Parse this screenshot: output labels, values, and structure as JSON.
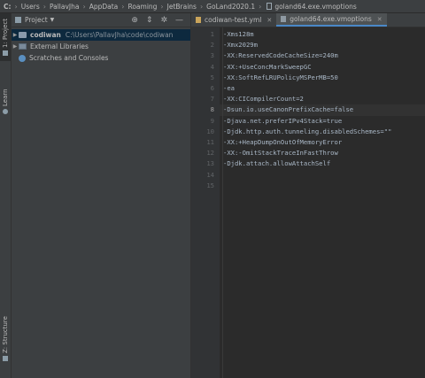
{
  "breadcrumb": {
    "items": [
      "C:",
      "Users",
      "PallavJha",
      "AppData",
      "Roaming",
      "JetBrains",
      "GoLand2020.1",
      "goland64.exe.vmoptions"
    ]
  },
  "sidebar": {
    "project_label": "1: Project",
    "learn_label": "Learn",
    "structure_label": "Z: Structure"
  },
  "project_panel": {
    "title": "Project",
    "tree": [
      {
        "name": "codiwan",
        "path": "C:\\Users\\PallavJha\\code\\codiwan"
      },
      {
        "name": "External Libraries"
      },
      {
        "name": "Scratches and Consoles"
      }
    ]
  },
  "tabs": [
    {
      "label": "codiwan-test.yml"
    },
    {
      "label": "goland64.exe.vmoptions"
    }
  ],
  "editor": {
    "current_line": 8,
    "lines": [
      "-Xms128m",
      "-Xmx2029m",
      "-XX:ReservedCodeCacheSize=240m",
      "-XX:+UseConcMarkSweepGC",
      "-XX:SoftRefLRUPolicyMSPerMB=50",
      "-ea",
      "-XX:CICompilerCount=2",
      "-Dsun.io.useCanonPrefixCache=false",
      "-Djava.net.preferIPv4Stack=true",
      "-Djdk.http.auth.tunneling.disabledSchemes=\"\"",
      "-XX:+HeapDumpOnOutOfMemoryError",
      "-XX:-OmitStackTraceInFastThrow",
      "-Djdk.attach.allowAttachSelf",
      "",
      ""
    ],
    "line_numbers": [
      "1",
      "2",
      "3",
      "4",
      "5",
      "6",
      "7",
      "8",
      "9",
      "10",
      "11",
      "12",
      "13",
      "14",
      "15"
    ]
  },
  "colors": {
    "background": "#2b2b2b",
    "panel": "#3c3f41",
    "accent": "#4a88c7",
    "text": "#a9b7c6"
  }
}
